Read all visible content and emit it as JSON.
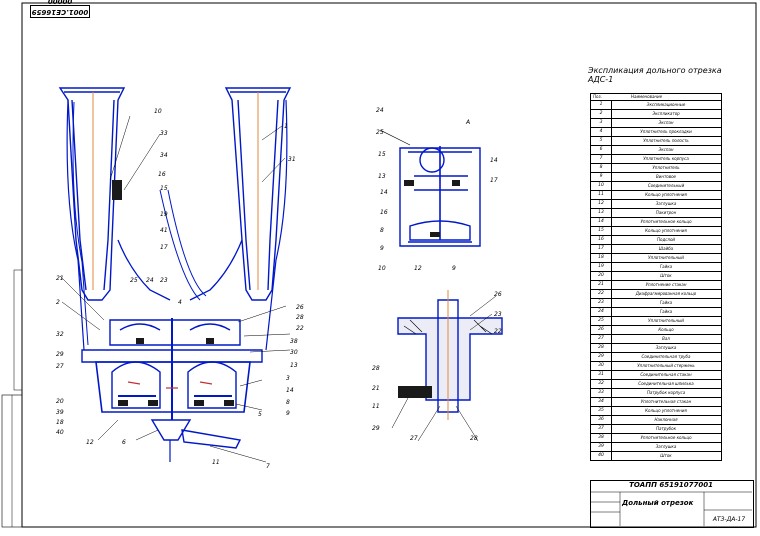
{
  "stamp": "0001.СЕ16659 00000",
  "table": {
    "title": "Экспликация дольного отрезка АДС-1",
    "col_num": "Поз.",
    "col_name": "Наименование",
    "rows": [
      "Экспликационные",
      "Экспликатор",
      "Экспан",
      "Уплотнитель прокладки",
      "Уплотнитель полость",
      "Экспан",
      "Уплотнитель корпуса",
      "Уплотнитель",
      "Винтовое",
      "Соединительный",
      "Кольцо уплотнения",
      "Заглушка",
      "Пакитрон",
      "Уплотнительное кольцо",
      "Кольцо уплотнения",
      "Подслой",
      "Шайба",
      "Уплотнительный",
      "Гайка",
      "Шток",
      "Уплотнение стакан",
      "Диафрагмированная кольцо",
      "Гайка",
      "Гайка",
      "Уплотнительный",
      "Кольцо",
      "Вал",
      "Заглушка",
      "Соединительная труба",
      "Уплотнительный стержень",
      "Соединительная стакан",
      "Соединительная шпилька",
      "Патрубок корпуса",
      "Уплотнительная стакан",
      "Кольцо уплотнения",
      "Наклонная",
      "Патрубок",
      "Уплотнительное кольцо",
      "Заглушка",
      "Шток"
    ]
  },
  "title_block": {
    "code": "ТОАПП 65191077001",
    "name": "Дольный отрезок",
    "sheet_code": "АТЗ-ДА-17"
  },
  "labels": {
    "l1": "1",
    "l2": "2",
    "l3": "3",
    "l4": "4",
    "l5": "5",
    "l6": "6",
    "l7": "7",
    "l8": "8",
    "l9": "9",
    "l10": "10",
    "l11": "11",
    "l12": "12",
    "l13": "13",
    "l14": "14",
    "l15": "15",
    "l16": "16",
    "l17": "17",
    "l18": "18",
    "l19": "19",
    "l20": "20",
    "l21": "21",
    "l22": "22",
    "l23": "23",
    "l24": "24",
    "l25": "25",
    "l26": "26",
    "l27": "27",
    "l28": "28",
    "l29": "29",
    "l30": "30",
    "l31": "31",
    "l32": "32",
    "l33": "33",
    "l34": "34",
    "l38": "38",
    "l39": "39",
    "l40": "40",
    "l41": "41",
    "lA": "А"
  }
}
